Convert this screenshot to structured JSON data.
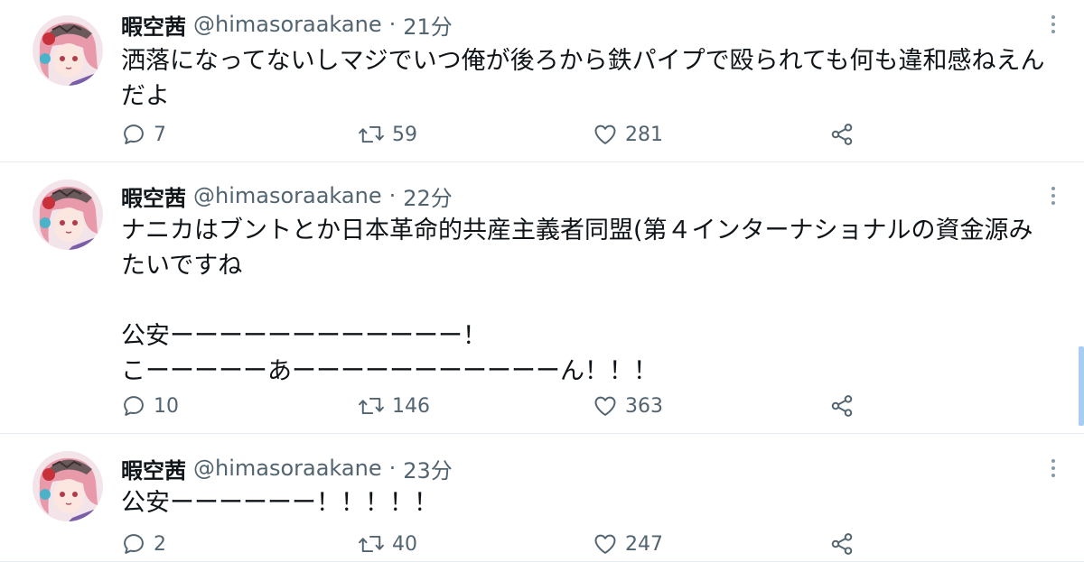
{
  "tweets": [
    {
      "name": "暇空茜",
      "handle": "@himasoraakane",
      "separator": "·",
      "time": "21分",
      "text": "洒落になってないしマジでいつ俺が後ろから鉄パイプで殴られても何も違和感ねえんだよ",
      "replies": "7",
      "retweets": "59",
      "likes": "281"
    },
    {
      "name": "暇空茜",
      "handle": "@himasoraakane",
      "separator": "·",
      "time": "22分",
      "text": "ナニカはブントとか日本革命的共産主義者同盟(第４インターナショナルの資金源みたいですね\n\n公安ーーーーーーーーーーーー！\nこーーーーーあーーーーーーーーーーーん！！！",
      "replies": "10",
      "retweets": "146",
      "likes": "363"
    },
    {
      "name": "暇空茜",
      "handle": "@himasoraakane",
      "separator": "·",
      "time": "23分",
      "text": "公安ーーーーーー！！！！！",
      "replies": "2",
      "retweets": "40",
      "likes": "247"
    }
  ],
  "icons": {
    "reply": "reply-icon",
    "retweet": "retweet-icon",
    "like": "heart-icon",
    "share": "share-icon",
    "more": "more-dots-icon"
  },
  "colors": {
    "text": "#0f1419",
    "secondary": "#536471",
    "divider": "#e6ecf0",
    "scrollbar": "#a9cdf0"
  }
}
